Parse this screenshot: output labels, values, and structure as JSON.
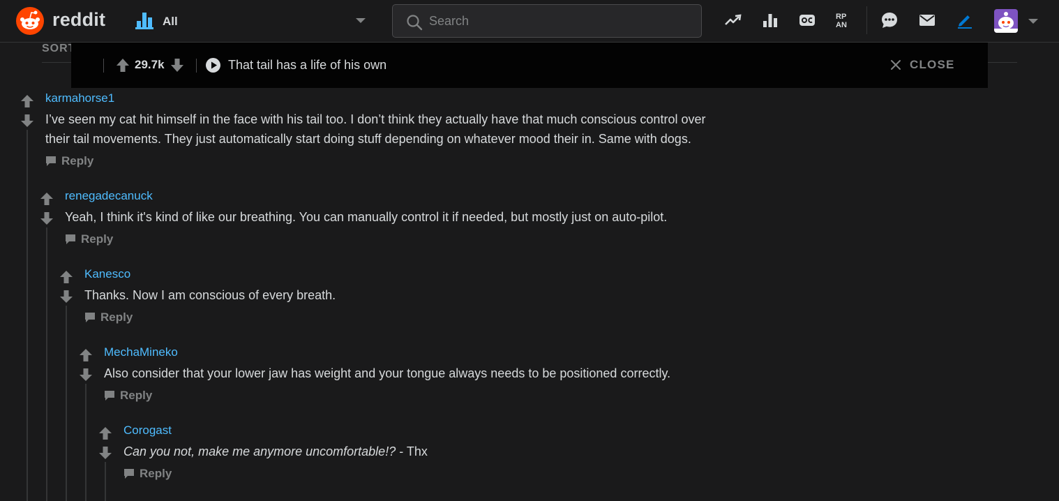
{
  "header": {
    "wordmark": "reddit",
    "community": "All",
    "search_placeholder": "Search",
    "icons": [
      "trending-icon",
      "leaderboard-icon",
      "oc-icon",
      "rpan-icon",
      "chat-icon",
      "mail-icon",
      "create-post-icon"
    ],
    "brand_color": "#ff4500"
  },
  "sort_label": "SORT",
  "postbar": {
    "score": "29.7k",
    "title": "That tail has a life of his own",
    "close_label": "CLOSE"
  },
  "comments": [
    {
      "author": "karmahorse1",
      "lines": [
        "I’ve seen my cat hit himself in the face with his tail too. I don’t think they actually have that much conscious control over",
        "their tail movements. They just automatically start doing stuff depending on whatever mood their in. Same with dogs."
      ],
      "reply_label": "Reply"
    },
    {
      "author": "renegadecanuck",
      "lines": [
        "Yeah, I think it's kind of like our breathing. You can manually control it if needed, but mostly just on auto-pilot."
      ],
      "reply_label": "Reply"
    },
    {
      "author": "Kanesco",
      "lines": [
        "Thanks. Now I am conscious of every breath."
      ],
      "reply_label": "Reply"
    },
    {
      "author": "MechaMineko",
      "lines": [
        "Also consider that your lower jaw has weight and your tongue always needs to be positioned correctly."
      ],
      "reply_label": "Reply"
    },
    {
      "author": "Corogast",
      "italic_text": "Can you not, make me anymore uncomfortable!?",
      "text_suffix": " - Thx",
      "reply_label": "Reply"
    }
  ],
  "colors": {
    "background": "#1a1a1b",
    "author_link": "#4fbcff",
    "text": "#d7dadc",
    "muted": "#818384"
  }
}
